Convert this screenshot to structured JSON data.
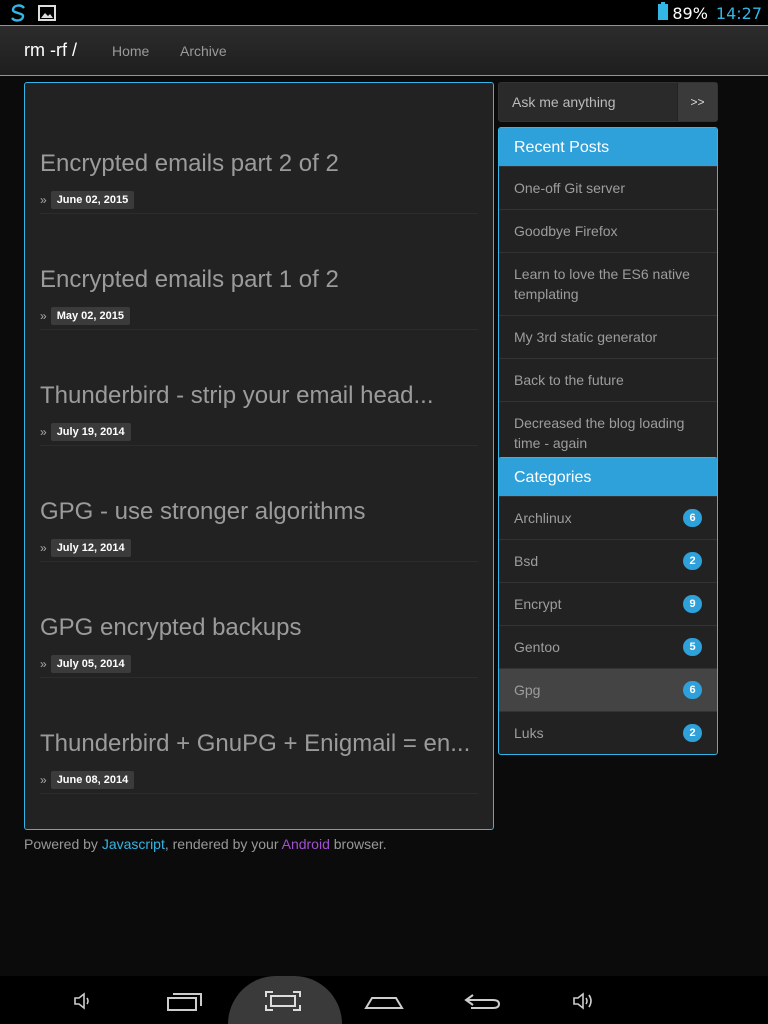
{
  "status_bar": {
    "battery_percent": "89%",
    "battery_level": 0.89,
    "clock": "14:27",
    "icons": [
      "sync-icon",
      "image-icon",
      "battery-icon"
    ]
  },
  "navbar": {
    "brand": "rm -rf /",
    "links": [
      "Home",
      "Archive"
    ]
  },
  "posts": [
    {
      "title": "Encrypted emails part 2 of 2",
      "date": "June 02, 2015"
    },
    {
      "title": "Encrypted emails part 1 of 2",
      "date": "May 02, 2015"
    },
    {
      "title": "Thunderbird - strip your email head...",
      "date": "July 19, 2014"
    },
    {
      "title": "GPG - use stronger algorithms",
      "date": "July 12, 2014"
    },
    {
      "title": "GPG encrypted backups",
      "date": "July 05, 2014"
    },
    {
      "title": "Thunderbird + GnuPG + Enigmail = en...",
      "date": "June 08, 2014"
    }
  ],
  "raquo": "»",
  "footer": {
    "prefix": "Powered by ",
    "js_link": "Javascript",
    "middle": ", rendered by your ",
    "android_link": "Android",
    "suffix": " browser."
  },
  "search": {
    "placeholder": "Ask me anything",
    "button": ">>"
  },
  "recent_posts": {
    "title": "Recent Posts",
    "items": [
      "One-off Git server",
      "Goodbye Firefox",
      "Learn to love the ES6 native templating",
      "My 3rd static generator",
      "Back to the future",
      "Decreased the blog loading time - again"
    ]
  },
  "categories": {
    "title": "Categories",
    "items": [
      {
        "label": "Archlinux",
        "count": "6"
      },
      {
        "label": "Bsd",
        "count": "2"
      },
      {
        "label": "Encrypt",
        "count": "9"
      },
      {
        "label": "Gentoo",
        "count": "5"
      },
      {
        "label": "Gpg",
        "count": "6"
      },
      {
        "label": "Luks",
        "count": "2"
      }
    ],
    "active_index": 4
  },
  "colors": {
    "accent": "#33b5e5",
    "panel_header": "#2ea0da",
    "android_link": "#a24fd1"
  },
  "system_nav": [
    "volume-down-icon",
    "recent-apps-icon",
    "screenshot-icon",
    "home-icon",
    "back-icon",
    "volume-up-icon"
  ]
}
